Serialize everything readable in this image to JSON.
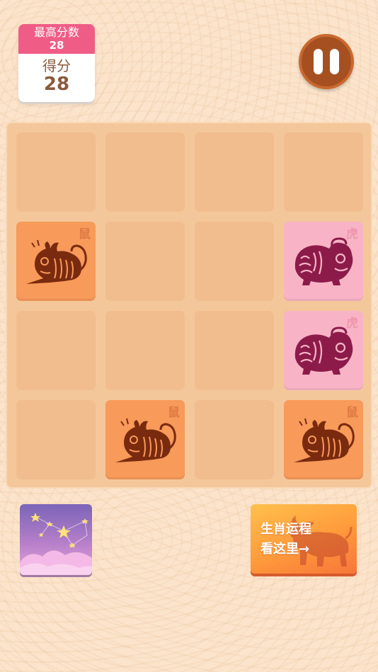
{
  "score_panel": {
    "best_label": "最高分数",
    "best_value": "28",
    "score_label": "得分",
    "score_value": "28"
  },
  "board": {
    "tiles": [
      {
        "zodiac": "鼠",
        "animal": "rat",
        "row": 2,
        "col": 1
      },
      {
        "zodiac": "虎",
        "animal": "tiger",
        "row": 2,
        "col": 4
      },
      {
        "zodiac": "虎",
        "animal": "tiger",
        "row": 3,
        "col": 4
      },
      {
        "zodiac": "鼠",
        "animal": "rat",
        "row": 4,
        "col": 2
      },
      {
        "zodiac": "鼠",
        "animal": "rat",
        "row": 4,
        "col": 4
      }
    ]
  },
  "buttons": {
    "pause_icon": "pause-icon",
    "constellation_icon": "constellation-stars-icon",
    "fortune_line1": "生肖运程",
    "fortune_line2": "看这里→"
  },
  "colors": {
    "background": "#fbe4cb",
    "board": "#f4c79a",
    "empty_cell": "#f1bd8e",
    "rat_tile": "#f79a5a",
    "tiger_tile": "#f8b4c6",
    "best_header": "#ef5d86",
    "pause_button": "#a65021"
  }
}
